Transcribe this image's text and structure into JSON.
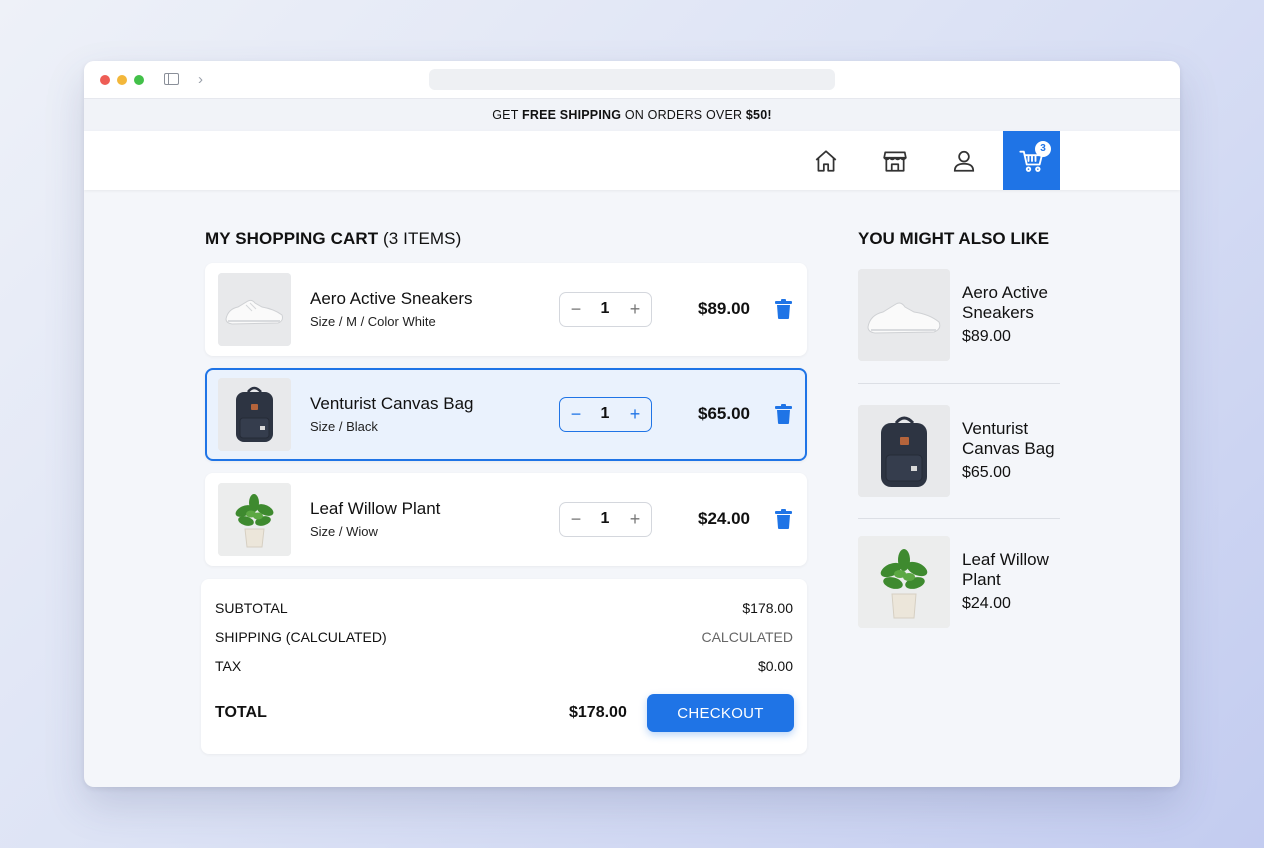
{
  "promo": {
    "prefix": "GET ",
    "highlight1": "FREE SHIPPING",
    "middle": " ON ORDERS OVER ",
    "highlight2": "$50!"
  },
  "nav": {
    "icons": [
      "home-icon",
      "store-icon",
      "account-icon",
      "cart-icon"
    ],
    "cart_count": "3"
  },
  "cart": {
    "title": "MY SHOPPING CART",
    "count_label": "(3 ITEMS)",
    "items": [
      {
        "name": "Aero Active Sneakers",
        "variant": "Size / M / Color White",
        "qty": "1",
        "price": "$89.00",
        "image": "sneaker"
      },
      {
        "name": "Venturist Canvas Bag",
        "variant": "Size / Black",
        "qty": "1",
        "price": "$65.00",
        "image": "backpack"
      },
      {
        "name": "Leaf Willow Plant",
        "variant": "Size / Wiow",
        "qty": "1",
        "price": "$24.00",
        "image": "plant"
      }
    ],
    "minus_label": "−",
    "plus_label": "+"
  },
  "summary": {
    "subtotal_label": "SUBTOTAL",
    "subtotal_value": "$178.00",
    "shipping_label": "SHIPPING (CALCULATED)",
    "shipping_value": "CALCULATED",
    "tax_label": "TAX",
    "tax_value": "$0.00",
    "total_label": "TOTAL",
    "total_value": "$178.00",
    "checkout_label": "CHECKOUT"
  },
  "recommendations": {
    "title": "YOU MIGHT ALSO LIKE",
    "items": [
      {
        "name": "Aero Active Sneakers",
        "price": "$89.00",
        "image": "sneaker"
      },
      {
        "name": "Venturist Canvas Bag",
        "price": "$65.00",
        "image": "backpack"
      },
      {
        "name": "Leaf Willow Plant",
        "price": "$24.00",
        "image": "plant"
      }
    ]
  },
  "colors": {
    "accent": "#1f74e6",
    "selected_bg": "#eaf2fd"
  }
}
